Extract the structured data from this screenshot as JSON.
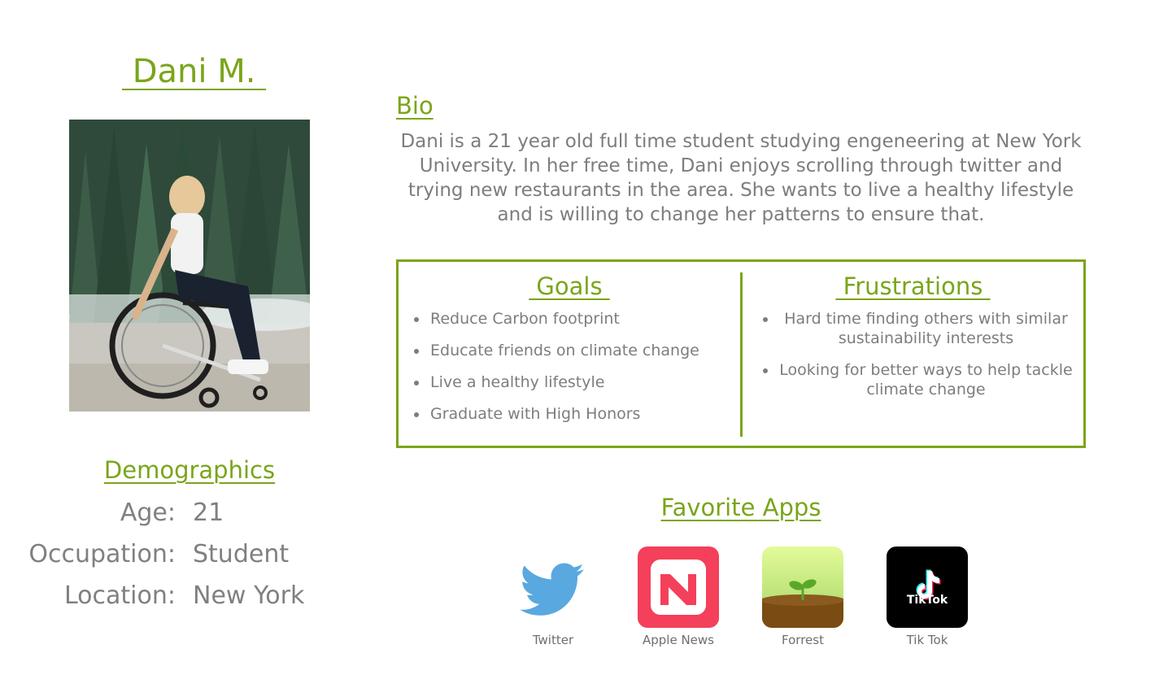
{
  "persona": {
    "name": " Dani M. "
  },
  "demographics": {
    "title": "Demographics",
    "rows": [
      {
        "label": "Age:",
        "value": "21"
      },
      {
        "label": "Occupation:",
        "value": "Student"
      },
      {
        "label": "Location:",
        "value": "New York"
      }
    ]
  },
  "bio": {
    "title": "Bio",
    "text": "Dani is a 21 year old full time student studying engeneering at New York University. In her free time, Dani enjoys scrolling through twitter and trying new restaurants in the area. She wants to live a healthy lifestyle and is willing to change her patterns to ensure that."
  },
  "goals": {
    "title": " Goals ",
    "items": [
      "Reduce Carbon footprint",
      "Educate friends on climate change",
      "Live a healthy lifestyle",
      "Graduate with High Honors"
    ]
  },
  "frustrations": {
    "title": " Frustrations ",
    "items": [
      "Hard time finding others with similar sustainability interests",
      "Looking for better ways to help tackle climate change"
    ]
  },
  "favorite_apps": {
    "title": "Favorite Apps",
    "apps": [
      {
        "label": "Twitter",
        "icon": "twitter-icon"
      },
      {
        "label": "Apple News",
        "icon": "apple-news-icon"
      },
      {
        "label": "Forrest",
        "icon": "forest-icon"
      },
      {
        "label": "Tik Tok",
        "icon": "tiktok-icon",
        "icon_text": "TikTok"
      }
    ]
  },
  "colors": {
    "accent": "#7aa51a",
    "text": "#7d7d7d"
  }
}
